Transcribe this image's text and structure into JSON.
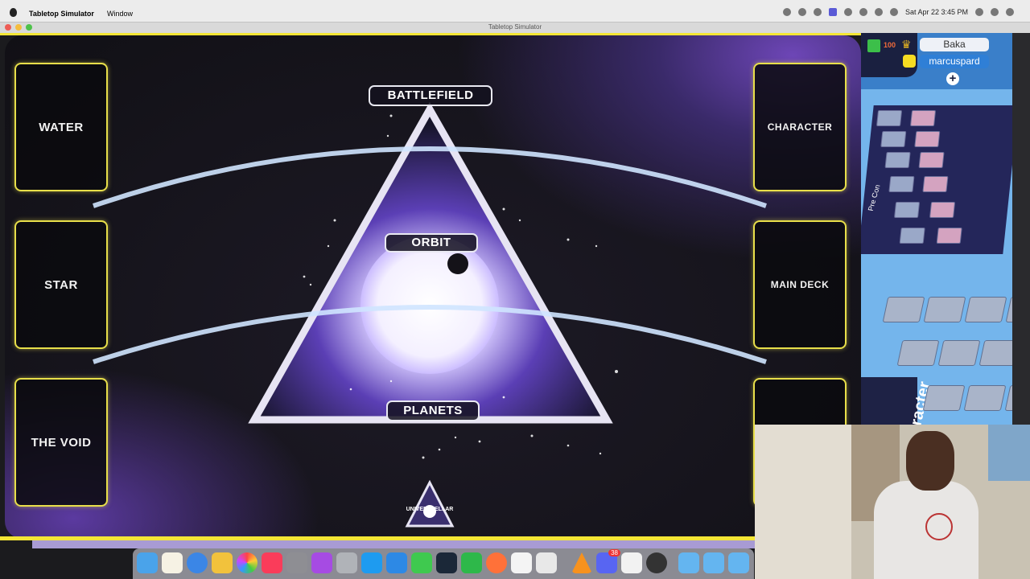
{
  "menubar": {
    "app_name": "Tabletop Simulator",
    "menu_window": "Window",
    "datetime": "Sat Apr 22  3:45 PM"
  },
  "window": {
    "title": "Tabletop Simulator"
  },
  "mat": {
    "zones_left": [
      "WATER",
      "STAR",
      "THE VOID"
    ],
    "zones_right": [
      "CHARACTER",
      "MAIN DECK"
    ],
    "battlefield": "BATTLEFIELD",
    "orbit": "ORBIT",
    "planets": "PLANETS",
    "logo_text": "UNIVERSTELLAR"
  },
  "players": {
    "score": "100",
    "list": [
      "Baka",
      "marcuspard"
    ]
  },
  "sidebar": {
    "pre_label": "Pre Con",
    "character_label": "aracter"
  },
  "colors": {
    "mat_border": "#f4e635",
    "zone_border": "#e8df4a",
    "sidebar_bg": "#74b5ec",
    "player_highlight": "#2f7fd6"
  },
  "dock": {
    "icons": [
      "finder-icon",
      "notes-icon",
      "safari-icon",
      "files-icon",
      "photos-icon",
      "music-icon",
      "settings-icon",
      "podcasts-icon",
      "compass-icon",
      "appstore-icon",
      "remote-icon",
      "messages-icon",
      "steam-icon",
      "numbers-icon",
      "firefox-icon",
      "doc-icon",
      "page-icon",
      "vlc-icon",
      "discord-icon",
      "solitaire-icon",
      "activity-icon",
      "folder-icon",
      "folder-icon-2",
      "folder-icon-3"
    ],
    "discord_badge": "38"
  }
}
